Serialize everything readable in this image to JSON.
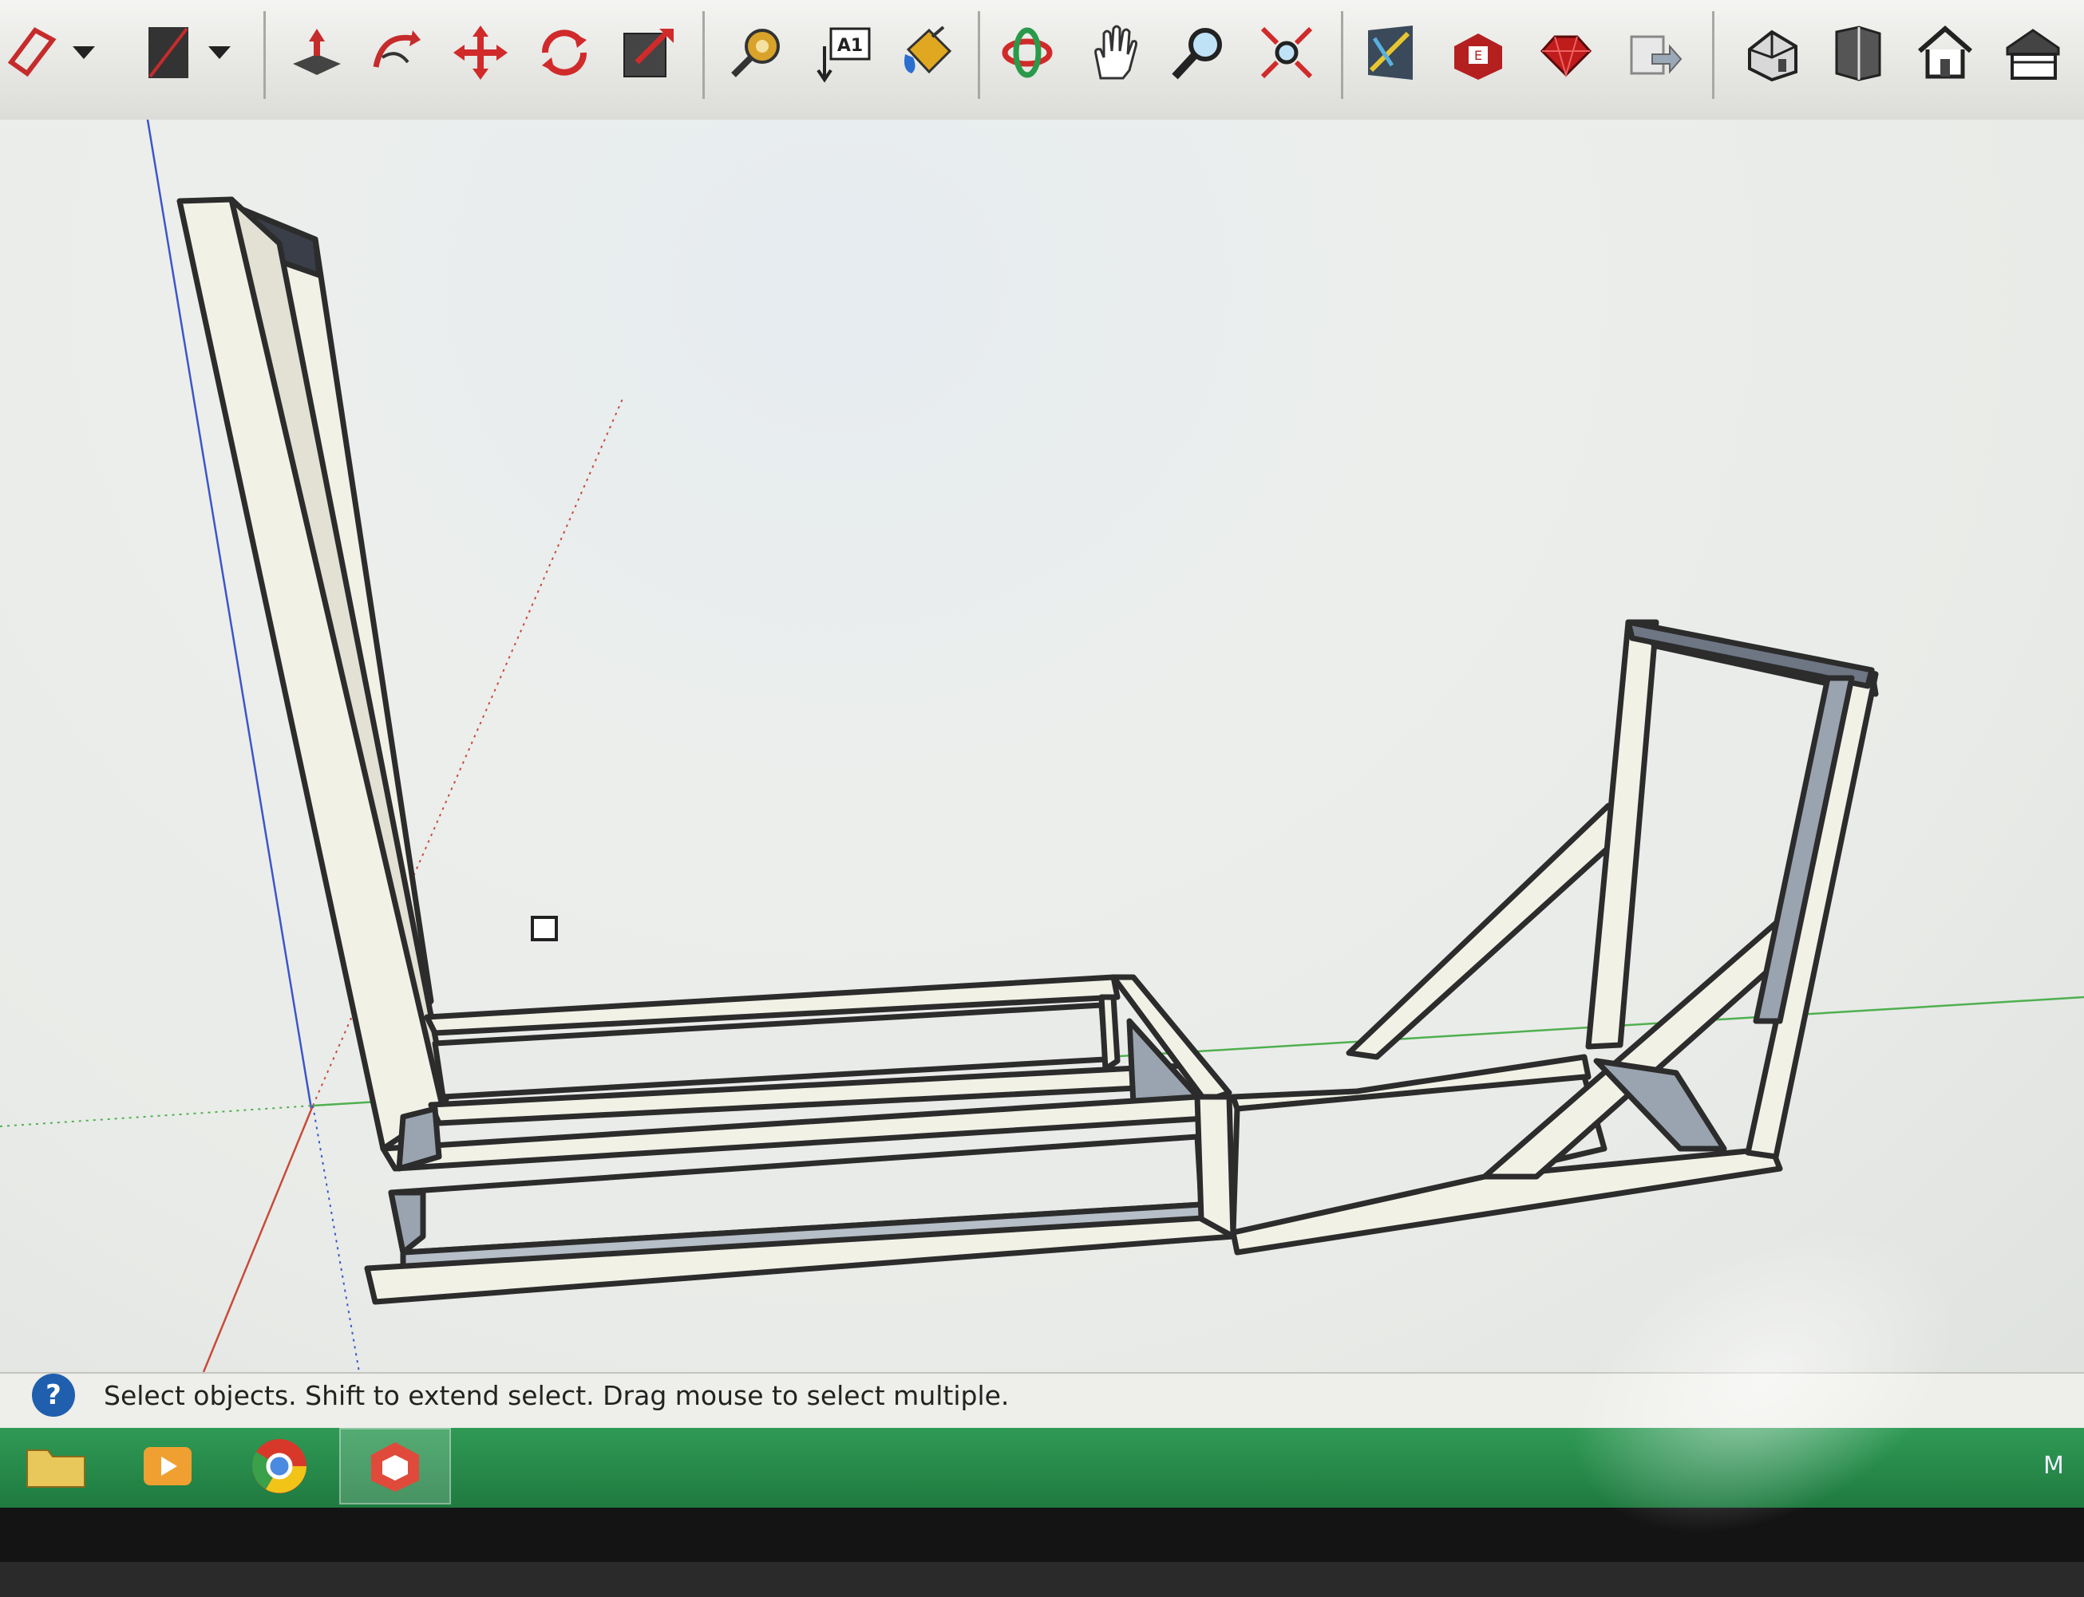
{
  "toolbar": {
    "tools": [
      {
        "name": "select-lasso",
        "icon": "lasso-icon"
      },
      {
        "name": "rectangle",
        "icon": "rectangle-icon"
      },
      {
        "name": "push-pull",
        "icon": "push-pull-icon"
      },
      {
        "name": "follow-me",
        "icon": "follow-me-icon"
      },
      {
        "name": "move",
        "icon": "move-icon"
      },
      {
        "name": "rotate",
        "icon": "rotate-icon"
      },
      {
        "name": "scale",
        "icon": "scale-icon"
      },
      {
        "name": "tape-measure",
        "icon": "tape-measure-icon"
      },
      {
        "name": "text",
        "icon": "text-icon"
      },
      {
        "name": "paint-bucket",
        "icon": "paint-bucket-icon"
      },
      {
        "name": "orbit",
        "icon": "orbit-icon"
      },
      {
        "name": "pan",
        "icon": "pan-hand-icon"
      },
      {
        "name": "zoom",
        "icon": "zoom-icon"
      },
      {
        "name": "zoom-extents",
        "icon": "zoom-extents-icon"
      },
      {
        "name": "warehouse",
        "icon": "warehouse-icon"
      },
      {
        "name": "extension-warehouse",
        "icon": "extension-icon"
      },
      {
        "name": "ruby",
        "icon": "ruby-icon"
      },
      {
        "name": "layout-send",
        "icon": "send-to-layout-icon"
      },
      {
        "name": "view-iso",
        "icon": "iso-house-icon"
      },
      {
        "name": "view-front",
        "icon": "front-view-icon"
      },
      {
        "name": "view-top",
        "icon": "top-house-icon"
      },
      {
        "name": "view-right",
        "icon": "right-house-icon"
      }
    ],
    "text_tool_label": "A1"
  },
  "status": {
    "message": "Select objects. Shift to extend select. Drag mouse to select multiple.",
    "help": "?"
  },
  "taskbar": {
    "apps": [
      "file-explorer",
      "media-player",
      "chrome",
      "sketchup"
    ],
    "tray_text": "M"
  },
  "colors": {
    "frame_face": "#f2f1e6",
    "frame_inner": "#9aa4b0",
    "frame_dark": "#3a3e48",
    "outline": "#2c2c2c",
    "axis_red": "#c84a3a",
    "axis_green": "#4fb04f",
    "axis_blue": "#3c56c8",
    "taskbar": "#2a8a4a"
  }
}
